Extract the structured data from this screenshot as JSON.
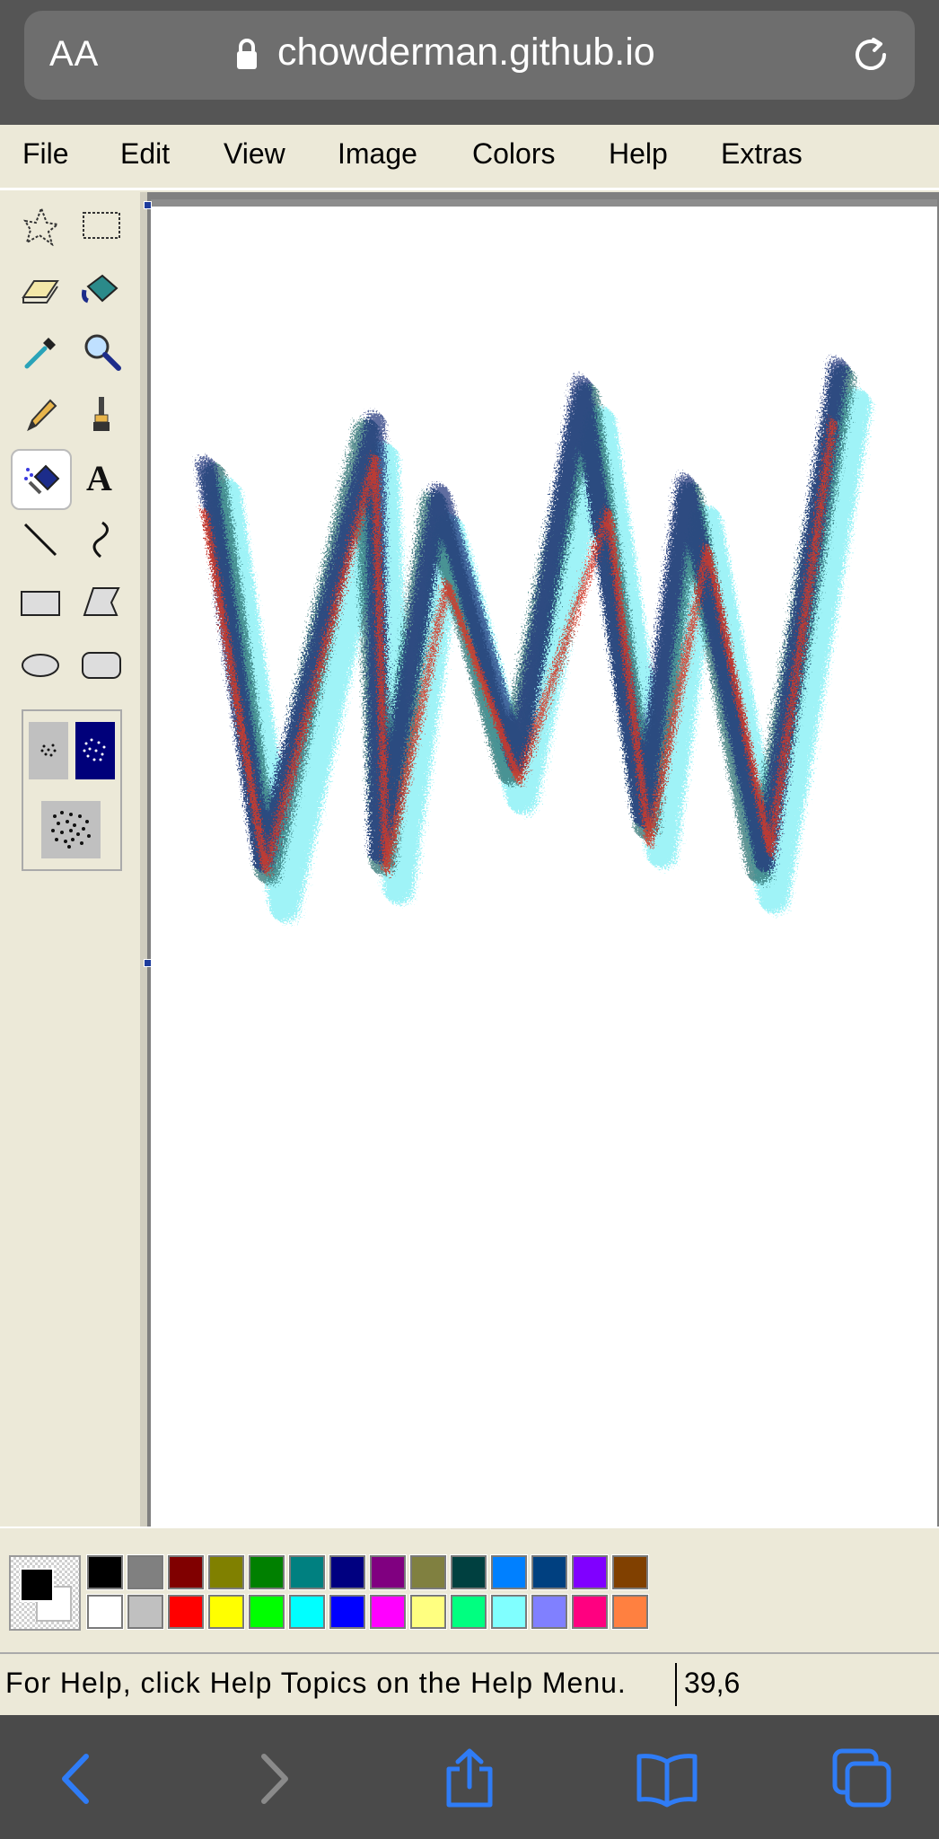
{
  "browser": {
    "text_size_label": "AA",
    "url": "chowderman.github.io",
    "accent_color": "#2f7cf6"
  },
  "menu": {
    "items": [
      "File",
      "Edit",
      "View",
      "Image",
      "Colors",
      "Help",
      "Extras"
    ]
  },
  "toolbox": {
    "tools": [
      "free-form-select-icon",
      "rect-select-icon",
      "eraser-icon",
      "fill-bucket-icon",
      "eyedropper-icon",
      "magnifier-icon",
      "pencil-icon",
      "brush-icon",
      "airbrush-icon",
      "text-icon",
      "line-icon",
      "curve-icon",
      "rectangle-icon",
      "polygon-icon",
      "ellipse-icon",
      "rounded-rect-icon"
    ],
    "selected_tool": "airbrush-icon"
  },
  "palette": {
    "foreground": "#000000",
    "background": "#ffffff",
    "top_row": [
      "#000000",
      "#808080",
      "#800000",
      "#808000",
      "#008000",
      "#008080",
      "#000080",
      "#800080",
      "#808040",
      "#004040",
      "#0080ff",
      "#004080",
      "#8000ff",
      "#804000"
    ],
    "bottom_row": [
      "#ffffff",
      "#c0c0c0",
      "#ff0000",
      "#ffff00",
      "#00ff00",
      "#00ffff",
      "#0000ff",
      "#ff00ff",
      "#ffff80",
      "#00ff80",
      "#80ffff",
      "#8080ff",
      "#ff0080",
      "#ff8040"
    ]
  },
  "status": {
    "help_text": "For Help, click Help Topics on the Help Menu.",
    "coords": "39,6"
  }
}
